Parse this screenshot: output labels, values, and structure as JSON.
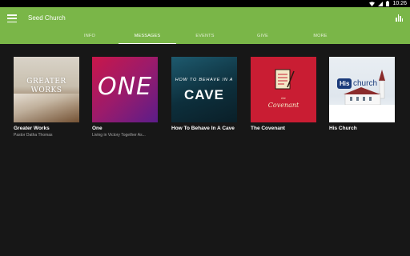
{
  "status_bar": {
    "time": "10:26"
  },
  "app": {
    "title": "Seed Church"
  },
  "tabs": [
    {
      "label": "INFO"
    },
    {
      "label": "MESSAGES"
    },
    {
      "label": "EVENTS"
    },
    {
      "label": "GIVE"
    },
    {
      "label": "MORE"
    }
  ],
  "active_tab": "MESSAGES",
  "series": [
    {
      "title": "Greater Works",
      "subtitle": "Pastor Datha Thomas",
      "art": {
        "line1": "GREATER",
        "line2": "WORKS"
      }
    },
    {
      "title": "One",
      "subtitle": "Living in Victory Together As...",
      "art": {
        "big": "ONE"
      }
    },
    {
      "title": "How To Behave In A Cave",
      "subtitle": "",
      "art": {
        "line1": "HOW TO BEHAVE IN A",
        "line2": "CAVE"
      }
    },
    {
      "title": "The Covenant",
      "subtitle": "",
      "art": {
        "line1": "the",
        "line2": "Covenant"
      }
    },
    {
      "title": "His Church",
      "subtitle": "",
      "art": {
        "badge": "His",
        "rest": "church"
      }
    }
  ],
  "colors": {
    "appbar": "#7ab648",
    "background": "#171717",
    "status_bar": "#000000"
  }
}
